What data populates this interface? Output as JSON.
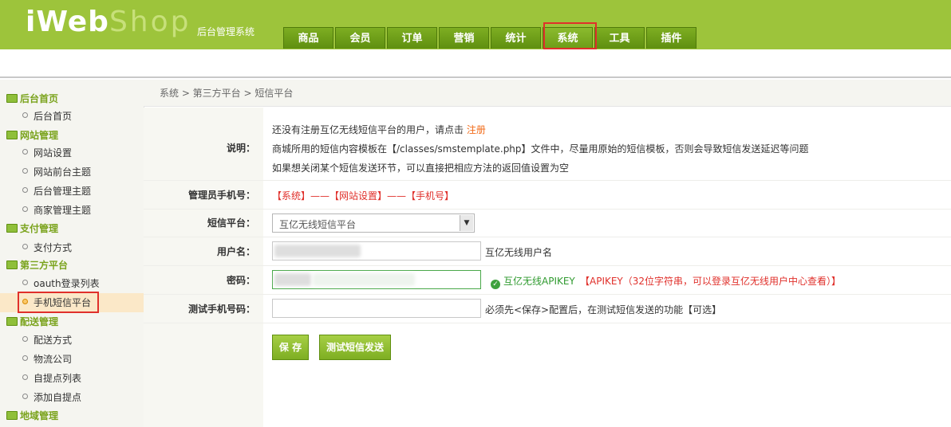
{
  "header": {
    "logo_prefix": "iWeb",
    "logo_suffix": "Shop",
    "subtitle": "后台管理系统",
    "nav": [
      "商品",
      "会员",
      "订单",
      "营销",
      "统计",
      "系统",
      "工具",
      "插件"
    ],
    "active_nav": "系统"
  },
  "sidebar": {
    "sections": [
      {
        "title": "后台首页",
        "items": [
          "后台首页"
        ]
      },
      {
        "title": "网站管理",
        "items": [
          "网站设置",
          "网站前台主题",
          "后台管理主题",
          "商家管理主题"
        ]
      },
      {
        "title": "支付管理",
        "items": [
          "支付方式"
        ]
      },
      {
        "title": "第三方平台",
        "items": [
          "oauth登录列表",
          "手机短信平台"
        ]
      },
      {
        "title": "配送管理",
        "items": [
          "配送方式",
          "物流公司",
          "自提点列表",
          "添加自提点"
        ]
      },
      {
        "title": "地域管理",
        "items": []
      }
    ],
    "active_item": "手机短信平台"
  },
  "breadcrumb": "系统 > 第三方平台 > 短信平台",
  "form": {
    "desc_label": "说明：",
    "desc_line1_prefix": "还没有注册互亿无线短信平台的用户，请点击",
    "desc_line1_link": "注册",
    "desc_line2": "商城所用的短信内容模板在【/classes/smstemplate.php】文件中，尽量用原始的短信模板，否则会导致短信发送延迟等问题",
    "desc_line3": "如果想关闭某个短信发送环节，可以直接把相应方法的返回值设置为空",
    "admin_phone_label": "管理员手机号：",
    "admin_phone_hint": "【系统】——【网站设置】——【手机号】",
    "platform_label": "短信平台：",
    "platform_value": "互亿无线短信平台",
    "username_label": "用户名：",
    "username_hint": "互亿无线用户名",
    "password_label": "密码：",
    "password_ok_text": "互亿无线APIKEY",
    "password_hint": "【APIKEY（32位字符串，可以登录互亿无线用户中心查看）】",
    "test_phone_label": "测试手机号码：",
    "test_phone_hint": "必须先<保存>配置后，在测试短信发送的功能【可选】",
    "save_button": "保 存",
    "test_button": "测试短信发送"
  },
  "colors": {
    "header_green": "#9dc43b",
    "nav_green": "#6d9d18",
    "highlight_red": "#e0302b",
    "link_orange": "#f26c1a",
    "sidebar_green": "#7aa31c"
  }
}
